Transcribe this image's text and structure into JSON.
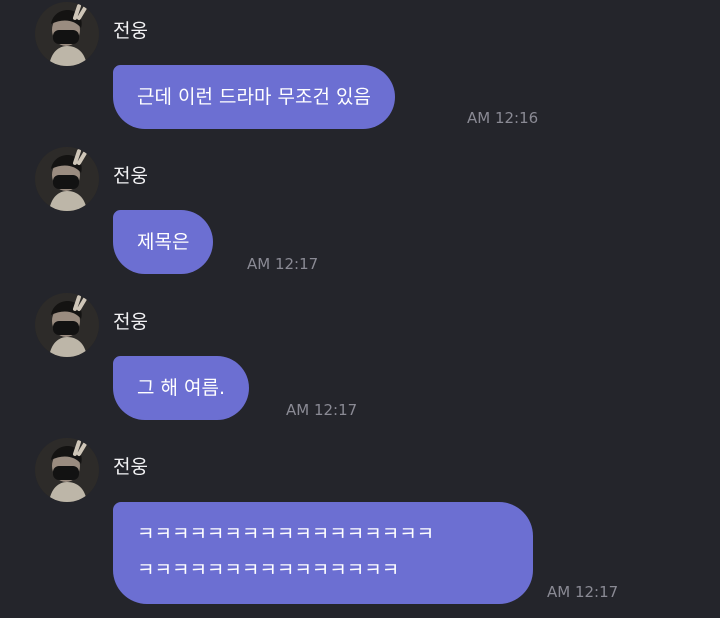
{
  "messages": [
    {
      "sender": "전웅",
      "avatar_icon": "profile-photo-avatar",
      "lines": [
        "근데 이런 드라마 무조건 있음"
      ],
      "time": "AM 12:16"
    },
    {
      "sender": "전웅",
      "avatar_icon": "profile-photo-avatar",
      "lines": [
        "제목은"
      ],
      "time": "AM 12:17"
    },
    {
      "sender": "전웅",
      "avatar_icon": "profile-photo-avatar",
      "lines": [
        "그 해 여름."
      ],
      "time": "AM 12:17"
    },
    {
      "sender": "전웅",
      "avatar_icon": "profile-photo-avatar",
      "lines": [
        "ㅋㅋㅋㅋㅋㅋㅋㅋㅋㅋㅋㅋㅋㅋㅋㅋㅋ",
        "ㅋㅋㅋㅋㅋㅋㅋㅋㅋㅋㅋㅋㅋㅋㅋ"
      ],
      "time": "AM 12:17"
    }
  ],
  "colors": {
    "background": "#24252b",
    "bubble": "#6c6fd2",
    "sender_text": "#f2f2f4",
    "time_text": "#8a8a94"
  }
}
